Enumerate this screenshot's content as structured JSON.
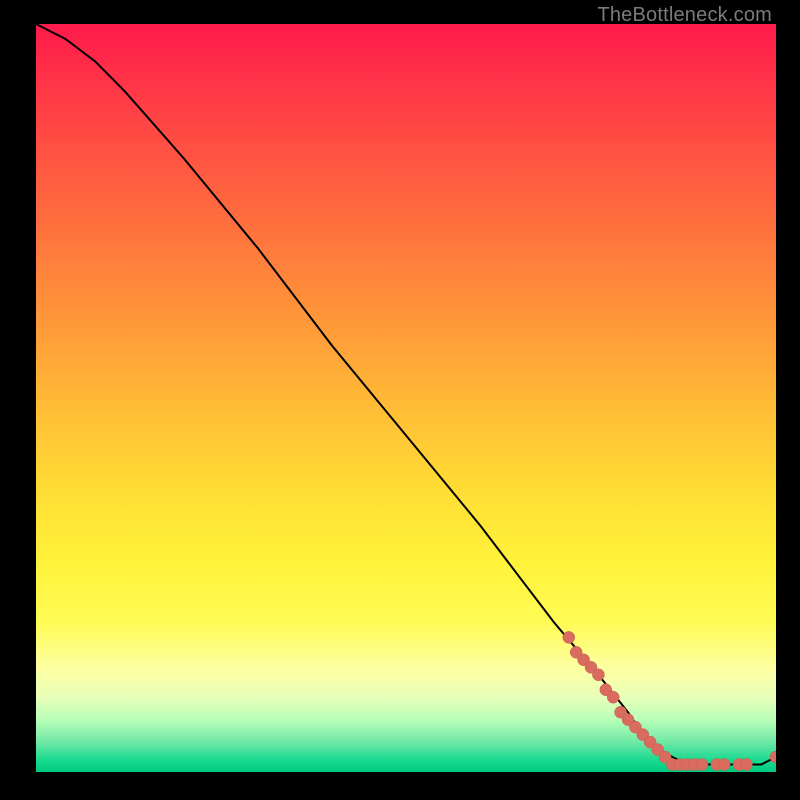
{
  "credit": "TheBottleneck.com",
  "colors": {
    "bg": "#000000",
    "gradient_top": "#ff1a4b",
    "gradient_bottom": "#00c97f",
    "curve": "#000000",
    "dot": "#d96c5f"
  },
  "chart_data": {
    "type": "line",
    "title": "",
    "xlabel": "",
    "ylabel": "",
    "xlim": [
      0,
      100
    ],
    "ylim": [
      0,
      100
    ],
    "series": [
      {
        "name": "curve",
        "x": [
          0,
          4,
          8,
          12,
          20,
          30,
          40,
          50,
          60,
          70,
          76,
          80,
          82,
          84,
          86,
          88,
          90,
          92,
          94,
          96,
          98,
          100
        ],
        "y": [
          100,
          98,
          95,
          91,
          82,
          70,
          57,
          45,
          33,
          20,
          13,
          8,
          5,
          3,
          2,
          1,
          1,
          1,
          1,
          1,
          1,
          2
        ]
      }
    ],
    "markers": [
      {
        "x": 72,
        "y": 18
      },
      {
        "x": 73,
        "y": 16
      },
      {
        "x": 74,
        "y": 15
      },
      {
        "x": 75,
        "y": 14
      },
      {
        "x": 76,
        "y": 13
      },
      {
        "x": 77,
        "y": 11
      },
      {
        "x": 78,
        "y": 10
      },
      {
        "x": 79,
        "y": 8
      },
      {
        "x": 80,
        "y": 7
      },
      {
        "x": 81,
        "y": 6
      },
      {
        "x": 82,
        "y": 5
      },
      {
        "x": 83,
        "y": 4
      },
      {
        "x": 84,
        "y": 3
      },
      {
        "x": 85,
        "y": 2
      },
      {
        "x": 86,
        "y": 1
      },
      {
        "x": 87,
        "y": 1
      },
      {
        "x": 88,
        "y": 1
      },
      {
        "x": 89,
        "y": 1
      },
      {
        "x": 90,
        "y": 1
      },
      {
        "x": 92,
        "y": 1
      },
      {
        "x": 93,
        "y": 1
      },
      {
        "x": 95,
        "y": 1
      },
      {
        "x": 96,
        "y": 1
      },
      {
        "x": 100,
        "y": 2
      }
    ]
  }
}
